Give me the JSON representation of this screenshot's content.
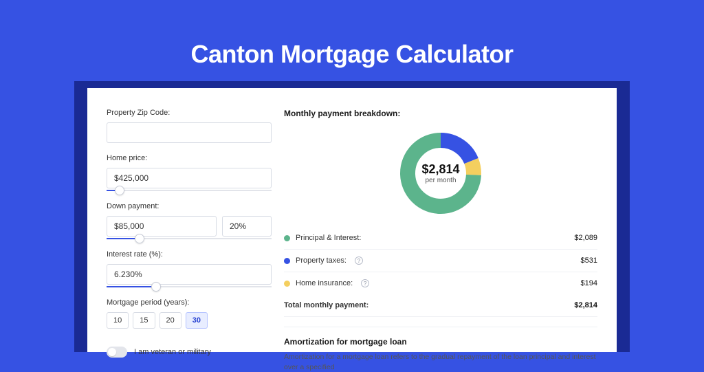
{
  "title": "Canton Mortgage Calculator",
  "form": {
    "zip": {
      "label": "Property Zip Code:",
      "value": ""
    },
    "home_price": {
      "label": "Home price:",
      "value": "$425,000",
      "slider_pct": 8
    },
    "down_payment": {
      "label": "Down payment:",
      "value": "$85,000",
      "pct_value": "20%",
      "slider_pct": 20
    },
    "interest_rate": {
      "label": "Interest rate (%):",
      "value": "6.230%",
      "slider_pct": 30
    },
    "period": {
      "label": "Mortgage period (years):",
      "options": [
        "10",
        "15",
        "20",
        "30"
      ],
      "selected": "30"
    },
    "veteran": {
      "label": "I am veteran or military",
      "checked": false
    }
  },
  "breakdown": {
    "title": "Monthly payment breakdown:",
    "center_amount": "$2,814",
    "center_sub": "per month",
    "items": [
      {
        "label": "Principal & Interest:",
        "value": "$2,089",
        "color": "#5cb48c",
        "info": false,
        "numeric": 2089
      },
      {
        "label": "Property taxes:",
        "value": "$531",
        "color": "#3652e3",
        "info": true,
        "numeric": 531
      },
      {
        "label": "Home insurance:",
        "value": "$194",
        "color": "#f4cf5f",
        "info": true,
        "numeric": 194
      }
    ],
    "total": {
      "label": "Total monthly payment:",
      "value": "$2,814"
    }
  },
  "amortization": {
    "title": "Amortization for mortgage loan",
    "text": "Amortization for a mortgage loan refers to the gradual repayment of the loan principal and interest over a specified"
  },
  "chart_data": {
    "type": "pie",
    "title": "Monthly payment breakdown",
    "categories": [
      "Principal & Interest",
      "Property taxes",
      "Home insurance"
    ],
    "values": [
      2089,
      531,
      194
    ],
    "colors": [
      "#5cb48c",
      "#3652e3",
      "#f4cf5f"
    ],
    "total": 2814,
    "center_label": "$2,814 per month"
  }
}
